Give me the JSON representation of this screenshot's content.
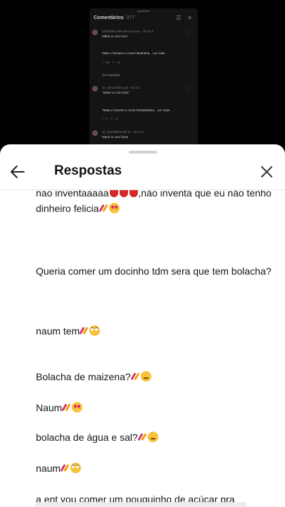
{
  "background": {
    "header_title": "Comentários",
    "header_count": "377",
    "comments": [
      {
        "user": "@fleflefle.delicatinhoooooo - há 22 h",
        "text": "Mãeh to com fomi",
        "text2": "Mata o homem e come hahahaha... Ler mais",
        "likes": "28",
        "replies_label": "32 respostas"
      },
      {
        "user": "@_nancheflins.pet - há 3 h",
        "text": "\"mãeh to com fomi\"",
        "text2": "\"Mata o homem e come hahahahaha... Ler mais",
        "likes": "1",
        "replies_label": ""
      },
      {
        "user": "@_fiterallfilbestcff·fe - há 13 h",
        "text": "Maeh to com fome",
        "text2": "",
        "likes": "",
        "replies_label": ""
      }
    ]
  },
  "sheet": {
    "title": "Respostas",
    "messages": [
      {
        "text_a": "nao inventaaaaa",
        "text_b": ",não inventa que eu não tenho dinheiro felicia"
      },
      {
        "text": "Queria comer um docinho  tdm sera que tem bolacha?"
      },
      {
        "text": "naum tem"
      },
      {
        "text": "Bolacha de maizena?"
      },
      {
        "text": "Naum"
      },
      {
        "text": "bolacha de água e sal?"
      },
      {
        "text": "naum"
      },
      {
        "text": "a ent vou comer um pouquinho de açúcar pra"
      }
    ]
  }
}
